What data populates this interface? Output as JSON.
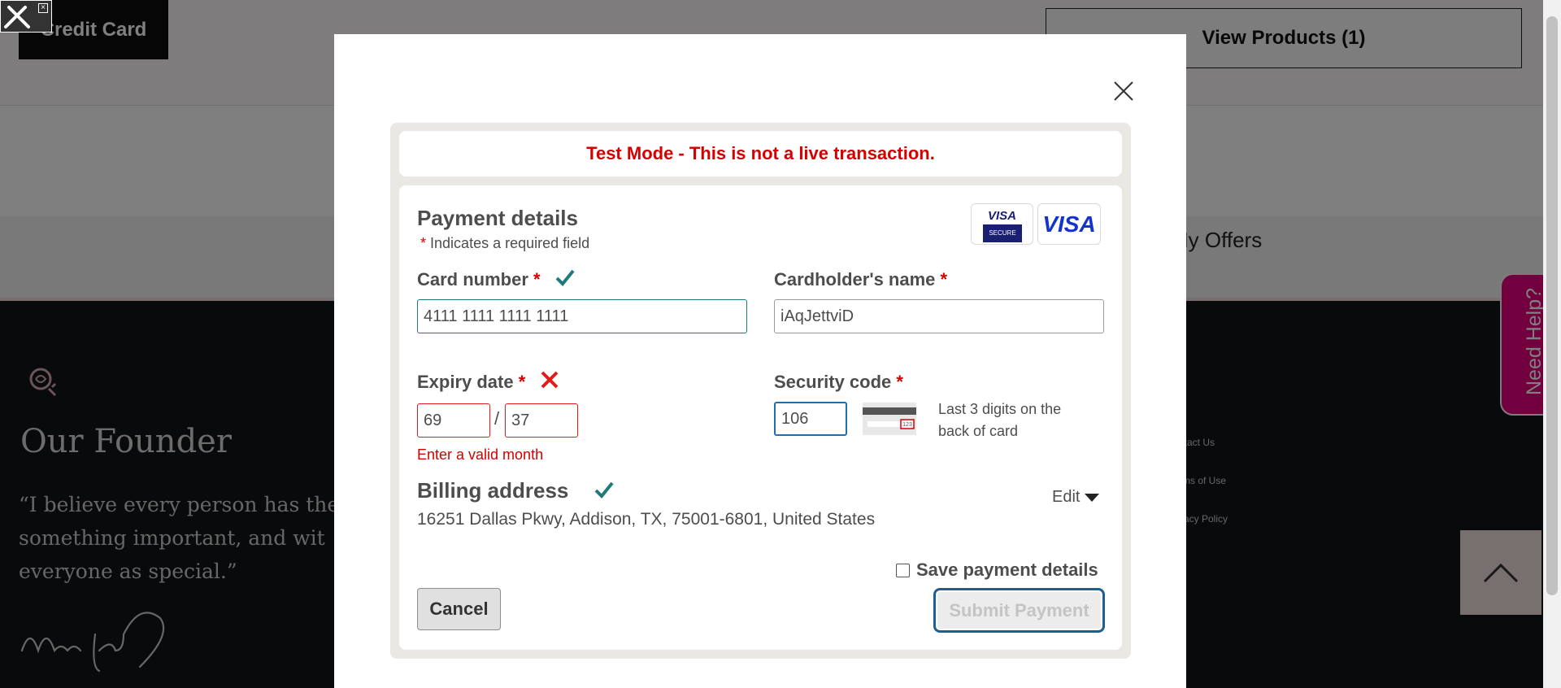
{
  "background": {
    "credit_button": "Credit Card",
    "view_products": "View Products (1)",
    "nav_offers": "My Offers",
    "footer_heading": "Our Founder",
    "founder_quote": "“I believe every person has the\nsomething important, and wit\neveryone as special.”",
    "signature": "Mary Kay",
    "footer_links": [
      "ntact Us",
      "rms of Use",
      "vacy Policy"
    ],
    "help_tab": "Need Help?"
  },
  "modal": {
    "test_banner": "Test Mode - This is not a live transaction.",
    "title": "Payment details",
    "required_marker": "*",
    "required_note": "Indicates a required field",
    "logos": {
      "visa_secure_top": "VISA",
      "visa_secure_bottom": "SECURE",
      "visa": "VISA"
    },
    "card_number": {
      "label": "Card number",
      "value": "4111 1111 1111 1111",
      "status": "valid"
    },
    "cardholder": {
      "label": "Cardholder's name",
      "value": "iAqJettviD"
    },
    "expiry": {
      "label": "Expiry date",
      "month": "69",
      "separator": "/",
      "year": "37",
      "status": "invalid",
      "error": "Enter a valid month"
    },
    "security_code": {
      "label": "Security code",
      "value": "106",
      "help": "Last 3 digits on the back of card",
      "card_digits": "123"
    },
    "billing": {
      "title": "Billing address",
      "address": "16251 Dallas Pkwy, Addison, TX, 75001-6801, United States",
      "edit_label": "Edit",
      "status": "valid"
    },
    "save_payment": {
      "label": "Save payment details",
      "checked": false
    },
    "cancel_label": "Cancel",
    "submit_label": "Submit Payment"
  },
  "colors": {
    "error": "#d50000",
    "valid": "#1f7a7a",
    "help_tab": "#e4007c",
    "focus": "#1f6fb0"
  }
}
